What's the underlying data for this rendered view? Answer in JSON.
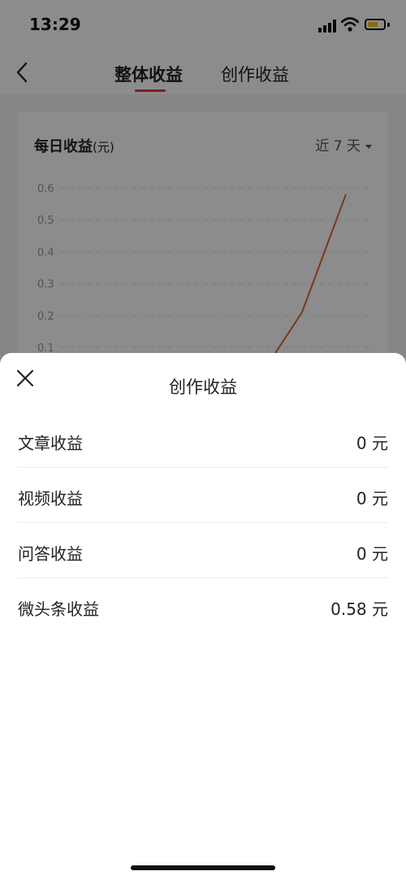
{
  "status_bar": {
    "time": "13:29"
  },
  "nav": {
    "tabs": [
      {
        "label": "整体收益",
        "active": true
      },
      {
        "label": "创作收益",
        "active": false
      }
    ]
  },
  "chart_card": {
    "title": "每日收益",
    "unit": "(元)",
    "range_label": "近 7 天"
  },
  "chart_data": {
    "type": "line",
    "title": "每日收益(元)",
    "y_ticks": [
      "0.6",
      "0.5",
      "0.4",
      "0.3",
      "0.2",
      "0.1"
    ],
    "ylim": [
      0,
      0.6
    ],
    "series": [
      {
        "values": [
          0,
          0,
          0,
          0,
          0,
          0.21,
          0.58
        ],
        "color": "#d9692e"
      }
    ],
    "grid": true
  },
  "sheet": {
    "title": "创作收益",
    "rows": [
      {
        "label": "文章收益",
        "value": "0 元"
      },
      {
        "label": "视频收益",
        "value": "0 元"
      },
      {
        "label": "问答收益",
        "value": "0 元"
      },
      {
        "label": "微头条收益",
        "value": "0.58 元"
      }
    ]
  },
  "colors": {
    "accent": "#e53935",
    "line": "#d9692e"
  }
}
